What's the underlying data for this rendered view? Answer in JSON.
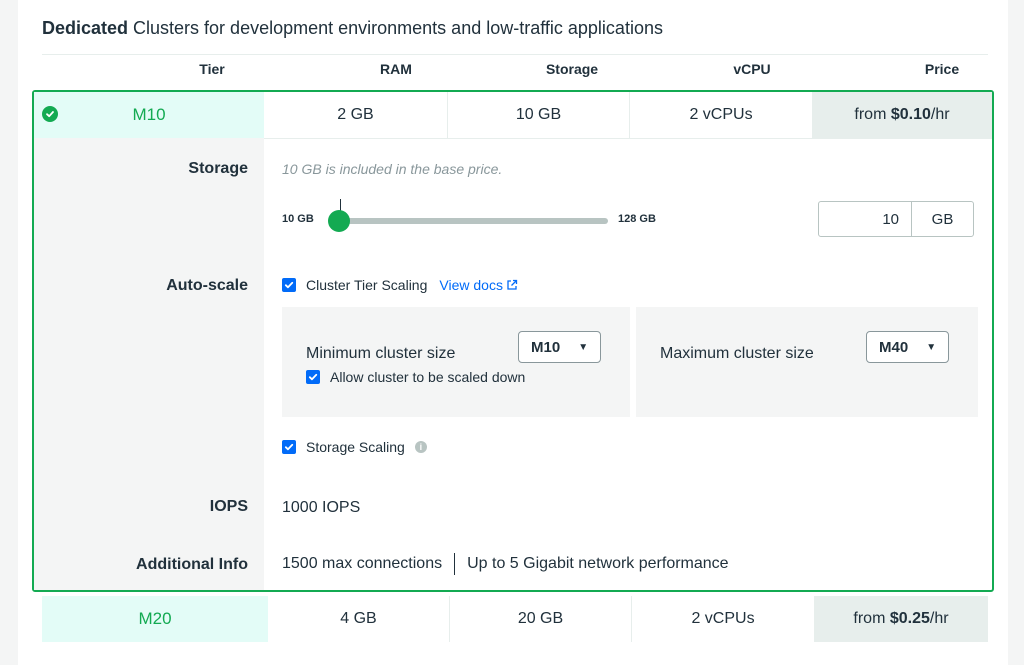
{
  "section": {
    "title_bold": "Dedicated",
    "title_rest": " Clusters for development environments and low-traffic applications"
  },
  "headers": {
    "tier": "Tier",
    "ram": "RAM",
    "storage": "Storage",
    "vcpu": "vCPU",
    "price": "Price"
  },
  "selected_cluster": {
    "tier": "M10",
    "ram": "2 GB",
    "storage": "10 GB",
    "vcpu": "2 vCPUs",
    "price_prefix": "from ",
    "price_value": "$0.10",
    "price_suffix": "/hr",
    "selected_icon": "check-circle-icon"
  },
  "storage": {
    "label": "Storage",
    "note": "10 GB is included in the base price.",
    "slider_min_label": "10 GB",
    "slider_max_label": "128 GB",
    "slider_fraction": 0.0,
    "input_value": "10",
    "unit": "GB"
  },
  "autoscale": {
    "label": "Auto-scale",
    "cluster_tier_scaling": "Cluster Tier Scaling",
    "view_docs": "View docs",
    "min_label": "Minimum cluster size",
    "min_value": "M10",
    "allow_scale_down": "Allow cluster to be scaled down",
    "max_label": "Maximum cluster size",
    "max_value": "M40",
    "storage_scaling": "Storage Scaling"
  },
  "iops": {
    "label": "IOPS",
    "value": "1000 IOPS"
  },
  "additional": {
    "label": "Additional Info",
    "connections": "1500 max connections",
    "network": "Up to 5 Gigabit network performance"
  },
  "next_cluster": {
    "tier": "M20",
    "ram": "4 GB",
    "storage": "20 GB",
    "vcpu": "2 vCPUs",
    "price_prefix": "from ",
    "price_value": "$0.25",
    "price_suffix": "/hr"
  },
  "colors": {
    "accent_green": "#13aa52",
    "link_blue": "#016bf8",
    "tier_bg": "#e3fcf7",
    "price_bg": "#e7eeec"
  }
}
